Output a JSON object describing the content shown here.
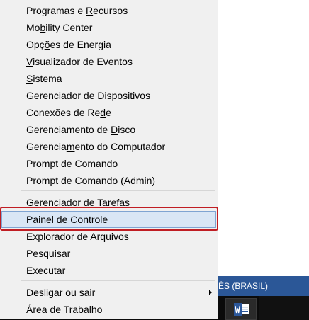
{
  "background": {
    "language_bar_text": "ÊS (BRASIL)",
    "taskbar_app": "word-icon"
  },
  "colors": {
    "menu_bg": "#f0f0f0",
    "hover_bg": "#d9e6f5",
    "hover_border": "#7fa4d2",
    "highlight_box": "#c01d23",
    "language_bar": "#2b5797",
    "taskbar": "#0a0a0a"
  },
  "menu": {
    "group1": [
      {
        "pre": "Programas e ",
        "acc": "R",
        "post": "ecursos"
      },
      {
        "pre": "Mo",
        "acc": "b",
        "post": "ility Center"
      },
      {
        "pre": "Opç",
        "acc": "õ",
        "post": "es de Energia"
      },
      {
        "pre": "",
        "acc": "V",
        "post": "isualizador de Eventos"
      },
      {
        "pre": "",
        "acc": "S",
        "post": "istema"
      },
      {
        "pre": "Gerenciador de Dispositivos",
        "acc": "",
        "post": ""
      },
      {
        "pre": "Conexões de Re",
        "acc": "d",
        "post": "e"
      },
      {
        "pre": "Gerenciamento de ",
        "acc": "D",
        "post": "isco"
      },
      {
        "pre": "Gerencia",
        "acc": "m",
        "post": "ento do Computador"
      },
      {
        "pre": "",
        "acc": "P",
        "post": "rompt de Comando"
      },
      {
        "pre": "Prompt de Comando (",
        "acc": "A",
        "post": "dmin)"
      }
    ],
    "group2": [
      {
        "pre": "Gerenciador de ",
        "acc": "T",
        "post": "arefas"
      },
      {
        "pre": "Painel de C",
        "acc": "o",
        "post": "ntrole"
      },
      {
        "pre": "E",
        "acc": "x",
        "post": "plorador de Arquivos"
      },
      {
        "pre": "Pes",
        "acc": "q",
        "post": "uisar"
      },
      {
        "pre": "",
        "acc": "E",
        "post": "xecutar"
      }
    ],
    "group3": [
      {
        "pre": "Desli",
        "acc": "g",
        "post": "ar ou sair"
      },
      {
        "pre": "",
        "acc": "Á",
        "post": "rea de Trabalho"
      }
    ]
  }
}
